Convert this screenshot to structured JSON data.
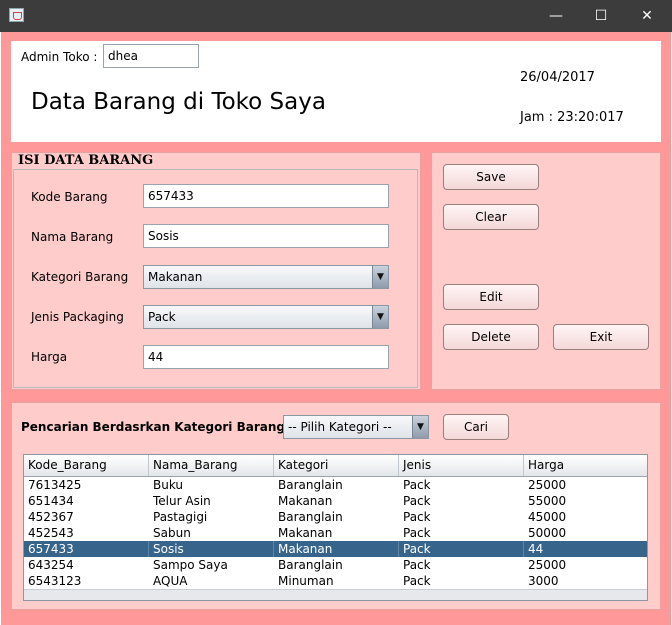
{
  "window": {
    "minimize_glyph": "—",
    "maximize_glyph": "☐",
    "close_glyph": "✕"
  },
  "header": {
    "admin_label": "Admin Toko :",
    "admin_value": "dhea",
    "title": "Data Barang di Toko Saya",
    "date": "26/04/2017",
    "time": "Jam : 23:20:017"
  },
  "form": {
    "section_title": "ISI DATA BARANG",
    "kode_label": "Kode Barang",
    "kode_value": "657433",
    "nama_label": "Nama Barang",
    "nama_value": "Sosis",
    "kategori_label": "Kategori Barang",
    "kategori_value": "Makanan",
    "packaging_label": "Jenis Packaging",
    "packaging_value": "Pack",
    "harga_label": "Harga",
    "harga_value": "44"
  },
  "actions": {
    "save": "Save",
    "clear": "Clear",
    "edit": "Edit",
    "delete": "Delete",
    "exit": "Exit"
  },
  "search": {
    "label": "Pencarian Berdasrkan Kategori Barang",
    "category_value": "-- Pilih Kategori --",
    "button": "Cari"
  },
  "table": {
    "columns": [
      "Kode_Barang",
      "Nama_Barang",
      "Kategori",
      "Jenis",
      "Harga"
    ],
    "rows": [
      [
        "7613425",
        "Buku",
        "Baranglain",
        "Pack",
        "25000"
      ],
      [
        "651434",
        "Telur Asin",
        "Makanan",
        "Pack",
        "55000"
      ],
      [
        "452367",
        "Pastagigi",
        "Baranglain",
        "Pack",
        "45000"
      ],
      [
        "452543",
        "Sabun",
        "Makanan",
        "Pack",
        "50000"
      ],
      [
        "657433",
        "Sosis",
        "Makanan",
        "Pack",
        "44"
      ],
      [
        "643254",
        "Sampo Saya",
        "Baranglain",
        "Pack",
        "25000"
      ],
      [
        "6543123",
        "AQUA",
        "Minuman",
        "Pack",
        "3000"
      ]
    ],
    "selected_row": 4
  },
  "colors": {
    "frame": "#ff9999",
    "panel": "#ffcccc",
    "selection": "#36648b"
  },
  "icons": {
    "window": "java-cup-icon",
    "dropdown": "chevron-down-icon"
  }
}
